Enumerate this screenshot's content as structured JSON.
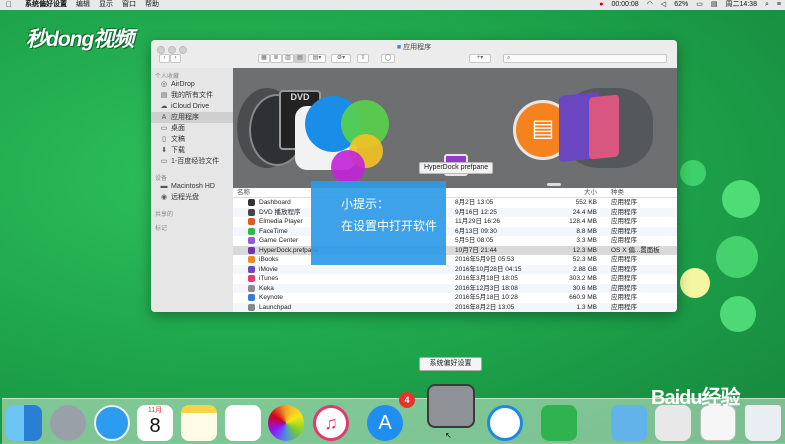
{
  "menubar": {
    "apple": "",
    "items": [
      "系统偏好设置",
      "编辑",
      "显示",
      "窗口",
      "帮助"
    ],
    "clock": "00:00:08",
    "battery": "62%",
    "datetime": "周二14:38"
  },
  "logo": "秒dong视频",
  "finder": {
    "title": "应用程序",
    "sidebar": {
      "favorites_header": "个人收藏",
      "favorites": [
        {
          "label": "AirDrop",
          "icon": "airdrop-icon"
        },
        {
          "label": "我的所有文件",
          "icon": "all-files-icon"
        },
        {
          "label": "iCloud Drive",
          "icon": "cloud-icon"
        },
        {
          "label": "应用程序",
          "icon": "applications-icon"
        },
        {
          "label": "桌面",
          "icon": "desktop-icon"
        },
        {
          "label": "文稿",
          "icon": "documents-icon"
        },
        {
          "label": "下载",
          "icon": "downloads-icon"
        },
        {
          "label": "1-百度经验文件",
          "icon": "folder-icon"
        }
      ],
      "devices_header": "设备",
      "devices": [
        {
          "label": "Macintosh HD",
          "icon": "disk-icon"
        },
        {
          "label": "远程光盘",
          "icon": "remote-disc-icon"
        }
      ],
      "shared_header": "共享的",
      "tags_header": "标记"
    },
    "coverflow_label": "HyperDock prefpane",
    "list": {
      "headers": {
        "name": "名称",
        "size": "大小",
        "kind": "种类"
      },
      "rows": [
        {
          "name": "Dashboard",
          "date": "8月2日 13:05",
          "size": "552 KB",
          "kind": "应用程序",
          "color": "#333333"
        },
        {
          "name": "DVD 播放程序",
          "date": "9月16日 12:25",
          "size": "24.4 MB",
          "kind": "应用程序",
          "color": "#444444"
        },
        {
          "name": "Elmedia Player",
          "date": "11月29日 16:26",
          "size": "128.4 MB",
          "kind": "应用程序",
          "color": "#e05a1b"
        },
        {
          "name": "FaceTime",
          "date": "6月13日 09:30",
          "size": "8.8 MB",
          "kind": "应用程序",
          "color": "#2fb84a"
        },
        {
          "name": "Game Center",
          "date": "5月5日 08:05",
          "size": "3.3 MB",
          "kind": "应用程序",
          "color": "#8d5fd3"
        },
        {
          "name": "HyperDock.prefpane",
          "date": "10月7日 21:44",
          "size": "12.3 MB",
          "kind": "OS X 偏...置面板",
          "color": "#6c3aa8"
        },
        {
          "name": "iBooks",
          "date": "2016年5月9日 05:53",
          "size": "52.3 MB",
          "kind": "应用程序",
          "color": "#f08a1e"
        },
        {
          "name": "iMovie",
          "date": "2016年10月28日 04:15",
          "size": "2.88 GB",
          "kind": "应用程序",
          "color": "#6b46c1"
        },
        {
          "name": "iTunes",
          "date": "2016年3月18日 18:05",
          "size": "303.2 MB",
          "kind": "应用程序",
          "color": "#e43b7d"
        },
        {
          "name": "Keka",
          "date": "2016年12月3日 18:08",
          "size": "30.6 MB",
          "kind": "应用程序",
          "color": "#8b8b8b"
        },
        {
          "name": "Keynote",
          "date": "2016年5月18日 10:28",
          "size": "660.9 MB",
          "kind": "应用程序",
          "color": "#2d7fd8"
        },
        {
          "name": "Launchpad",
          "date": "2016年8月2日 13:05",
          "size": "1.3 MB",
          "kind": "应用程序",
          "color": "#888888"
        }
      ]
    }
  },
  "tip": {
    "title": "小提示：",
    "text": "在设置中打开软件"
  },
  "dock": {
    "tooltip": "系统偏好设置",
    "calendar_day": "8",
    "calendar_month": "11月",
    "appstore_badge": "4",
    "apps": [
      "finder-icon",
      "launchpad-icon",
      "safari-icon",
      "calendar-icon",
      "notes-icon",
      "reminders-icon",
      "photos-icon",
      "itunes-icon",
      "app-store-icon",
      "system-preferences-icon",
      "facetime-icon",
      "keka-icon",
      "downloads-folder-icon",
      "preview-icon",
      "document-icon",
      "trash-icon"
    ]
  },
  "watermark": "Baidu经验"
}
